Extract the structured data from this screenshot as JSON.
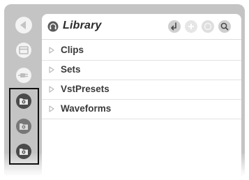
{
  "browser": {
    "title": "Library",
    "items": [
      {
        "label": "Clips"
      },
      {
        "label": "Sets"
      },
      {
        "label": "VstPresets"
      },
      {
        "label": "Waveforms"
      }
    ]
  },
  "icons": {
    "sidebar": [
      "back-arrow-icon",
      "clip-view-icon",
      "device-plug-icon",
      "folder-place-icon-1",
      "folder-place-icon-2",
      "folder-place-icon-3"
    ],
    "header": [
      "headphones-icon",
      "parent-folder-icon",
      "add-icon",
      "toggle-icon",
      "search-icon"
    ]
  },
  "colors": {
    "panel": "#c4c4c4",
    "icon_light": "#f2f2f2",
    "icon_dark": "#4a4a4a",
    "text": "#3a3a3a"
  }
}
